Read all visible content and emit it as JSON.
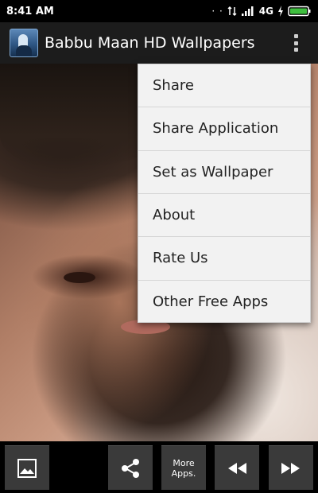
{
  "status_bar": {
    "time": "8:41 AM",
    "dots": "· ·",
    "network": "4G"
  },
  "action_bar": {
    "title": "Babbu Maan HD Wallpapers",
    "icon": "app-icon",
    "overflow_icon": "overflow-menu-icon"
  },
  "menu": {
    "items": [
      "Share",
      "Share Application",
      "Set as Wallpaper",
      "About",
      "Rate Us",
      "Other Free Apps"
    ]
  },
  "bottom_bar": {
    "gallery_icon": "image-icon",
    "share_icon": "share-icon",
    "more_label_line1": "More",
    "more_label_line2": "Apps.",
    "prev_icon": "rewind-icon",
    "next_icon": "fast-forward-icon"
  },
  "colors": {
    "status_bar_bg": "#000000",
    "action_bar_bg": "#1c1c1c",
    "menu_bg": "#f2f2f2",
    "battery_green": "#3fbf3f",
    "button_bg": "#3a3a3a"
  }
}
